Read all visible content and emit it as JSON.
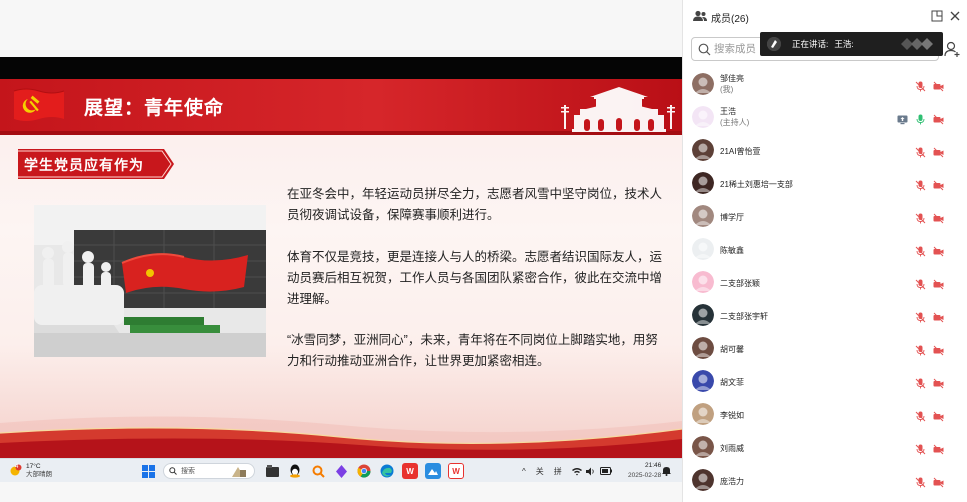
{
  "slide": {
    "title": "展望：青年使命",
    "section_tag": "学生党员应有作为",
    "paragraphs": [
      "在亚冬会中，年轻运动员拼尽全力，志愿者风雪中坚守岗位，技术人员彻夜调试设备，保障赛事顺利进行。",
      "体育不仅是竞技，更是连接人与人的桥梁。志愿者结识国际友人，运动员赛后相互祝贺，工作人员与各国团队紧密合作，彼此在交流中增进理解。",
      "“冰雪同梦，亚洲同心”，未来，青年将在不同岗位上脚踏实地，用努力和行动推动亚洲合作，让世界更加紧密相连。"
    ],
    "colors": {
      "header_red": "#d01d22",
      "dark_red": "#a40d12"
    }
  },
  "taskbar": {
    "weather": {
      "badge": "4",
      "temp": "17°C",
      "desc": "大部晴朗"
    },
    "search_label": "搜索",
    "tray": {
      "lang1": "关",
      "lang2": "拼"
    },
    "clock": {
      "time": "21:46",
      "date": "2025-02-28"
    },
    "app_icons": [
      "windows-start-icon",
      "file-explorer-icon",
      "qq-icon",
      "search-app-icon",
      "onenote-icon",
      "chrome-icon",
      "edge-icon",
      "wps-icon",
      "photos-icon",
      "wps-red-icon"
    ]
  },
  "panel": {
    "title": "成员(26)",
    "search_placeholder": "搜索成员",
    "speaking": {
      "label": "正在讲话:",
      "name": "王浩:"
    },
    "members": [
      {
        "name": "邹佳亮",
        "role": "(我)",
        "icons": [
          "mic-muted-icon",
          "camera-off-icon"
        ]
      },
      {
        "name": "王浩",
        "role": "(主持人)",
        "icons": [
          "screen-share-icon",
          "mic-active-icon",
          "camera-off-icon"
        ]
      },
      {
        "name": "21AI曾怡萱",
        "role": "",
        "icons": [
          "mic-muted-icon",
          "camera-off-icon"
        ]
      },
      {
        "name": "21稀土刘惠培一支部",
        "role": "",
        "icons": [
          "mic-muted-icon",
          "camera-off-icon"
        ]
      },
      {
        "name": "博学厅",
        "role": "",
        "icons": [
          "mic-muted-icon",
          "camera-off-icon"
        ]
      },
      {
        "name": "陈敏鑫",
        "role": "",
        "icons": [
          "mic-muted-icon",
          "camera-off-icon"
        ]
      },
      {
        "name": "二支部张颖",
        "role": "",
        "icons": [
          "mic-muted-icon",
          "camera-off-icon"
        ]
      },
      {
        "name": "二支部张宇轩",
        "role": "",
        "icons": [
          "mic-muted-icon",
          "camera-off-icon"
        ]
      },
      {
        "name": "胡可馨",
        "role": "",
        "icons": [
          "mic-muted-icon",
          "camera-off-icon"
        ]
      },
      {
        "name": "胡文菲",
        "role": "",
        "icons": [
          "mic-muted-icon",
          "camera-off-icon"
        ]
      },
      {
        "name": "李锐如",
        "role": "",
        "icons": [
          "mic-muted-icon",
          "camera-off-icon"
        ]
      },
      {
        "name": "刘雨威",
        "role": "",
        "icons": [
          "mic-muted-icon",
          "camera-off-icon"
        ]
      },
      {
        "name": "庞浩力",
        "role": "",
        "icons": [
          "mic-muted-icon",
          "camera-off-icon"
        ]
      }
    ],
    "avatar_colors": [
      "#8d6e63",
      "#f3e5f5",
      "#5d4037",
      "#3e2723",
      "#a1887f",
      "#eceff1",
      "#f8bbd0",
      "#263238",
      "#6d4c41",
      "#3949ab",
      "#c0a080",
      "#795548",
      "#4e342e"
    ]
  }
}
